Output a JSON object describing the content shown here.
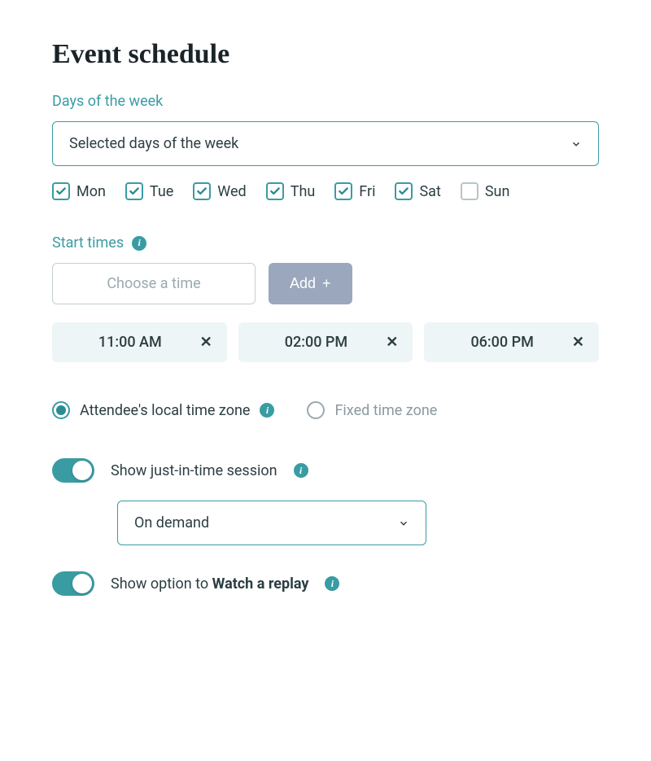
{
  "heading": "Event schedule",
  "days_label": "Days of the week",
  "days_select_value": "Selected days of the week",
  "days": [
    {
      "label": "Mon",
      "checked": true
    },
    {
      "label": "Tue",
      "checked": true
    },
    {
      "label": "Wed",
      "checked": true
    },
    {
      "label": "Thu",
      "checked": true
    },
    {
      "label": "Fri",
      "checked": true
    },
    {
      "label": "Sat",
      "checked": true
    },
    {
      "label": "Sun",
      "checked": false
    }
  ],
  "start_times_label": "Start times",
  "time_placeholder": "Choose a time",
  "add_label": "Add",
  "times": [
    "11:00 AM",
    "02:00 PM",
    "06:00 PM"
  ],
  "tz_options": {
    "local": "Attendee's local time zone",
    "fixed": "Fixed time zone",
    "selected": "local"
  },
  "jit": {
    "label": "Show just-in-time session",
    "on": true,
    "mode": "On demand"
  },
  "replay": {
    "prefix": "Show option to ",
    "bold": "Watch a replay",
    "on": true
  }
}
